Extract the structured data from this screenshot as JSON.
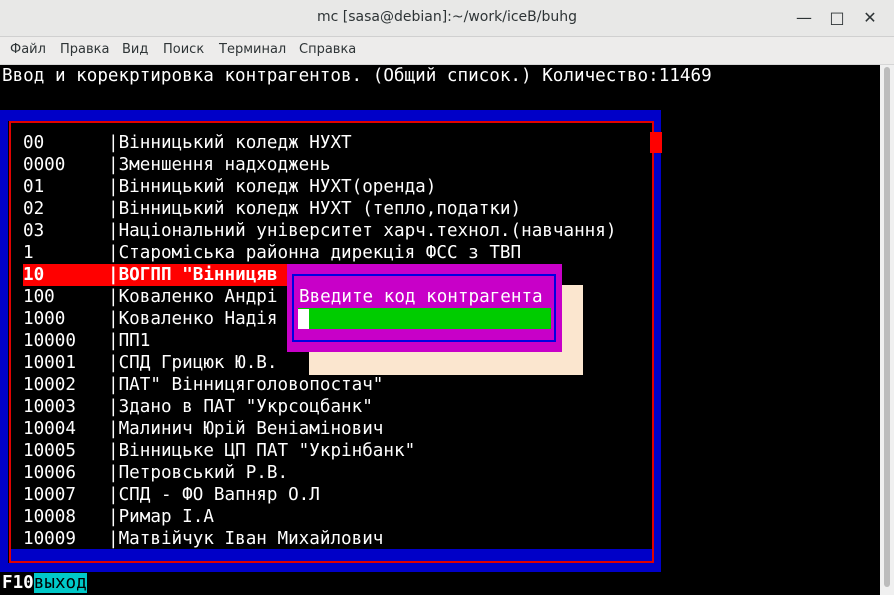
{
  "window": {
    "title": "mc [sasa@debian]:~/work/iceB/buhg"
  },
  "menu": [
    "Файл",
    "Правка",
    "Вид",
    "Поиск",
    "Терминал",
    "Справка"
  ],
  "screen": {
    "header": "Ввод и корекртировка контрагентов. (Общий список.) Количество:11469",
    "rows": [
      {
        "code": "00",
        "name": "Вінницький коледж НУХТ"
      },
      {
        "code": "0000",
        "name": "Зменшення надходжень"
      },
      {
        "code": "01",
        "name": "Вінницький коледж НУХТ(оренда)"
      },
      {
        "code": "02",
        "name": "Вінницький коледж НУХТ (тепло,податки)"
      },
      {
        "code": "03",
        "name": "Національний університет харч.технол.(навчання)"
      },
      {
        "code": "1",
        "name": "Староміська районна дирекція ФСС з ТВП"
      },
      {
        "code": "10",
        "name": "ВОГПП \"Вінницяв"
      },
      {
        "code": "100",
        "name": "Коваленко Андрі"
      },
      {
        "code": "1000",
        "name": "Коваленко Надія"
      },
      {
        "code": "10000",
        "name": "ПП1"
      },
      {
        "code": "10001",
        "name": "СПД Грицюк Ю.В."
      },
      {
        "code": "10002",
        "name": "ПАТ\" Вінницяголовопостач\""
      },
      {
        "code": "10003",
        "name": "Здано в ПАТ \"Укрсоцбанк\""
      },
      {
        "code": "10004",
        "name": "Малинич Юрій Веніамінович"
      },
      {
        "code": "10005",
        "name": "Вінницьке ЦП ПАТ \"Укрінбанк\""
      },
      {
        "code": "10006",
        "name": "Петровський Р.В."
      },
      {
        "code": "10007",
        "name": "СПД - ФО Вапняр О.Л"
      },
      {
        "code": "10008",
        "name": "Римар І.А"
      },
      {
        "code": "10009",
        "name": "Матвійчук Іван Михайлович"
      }
    ],
    "selected_index": 6,
    "dialog": {
      "label": "Введите код контрагента",
      "value": ""
    },
    "fkeys": {
      "key": "F10",
      "label": "выход"
    }
  },
  "colors": {
    "panel_blue": "#0000c8",
    "border_red": "#e00000",
    "dialog_magenta": "#c800c8",
    "input_green": "#00cc00",
    "fkey_cyan": "#00c8c8"
  }
}
